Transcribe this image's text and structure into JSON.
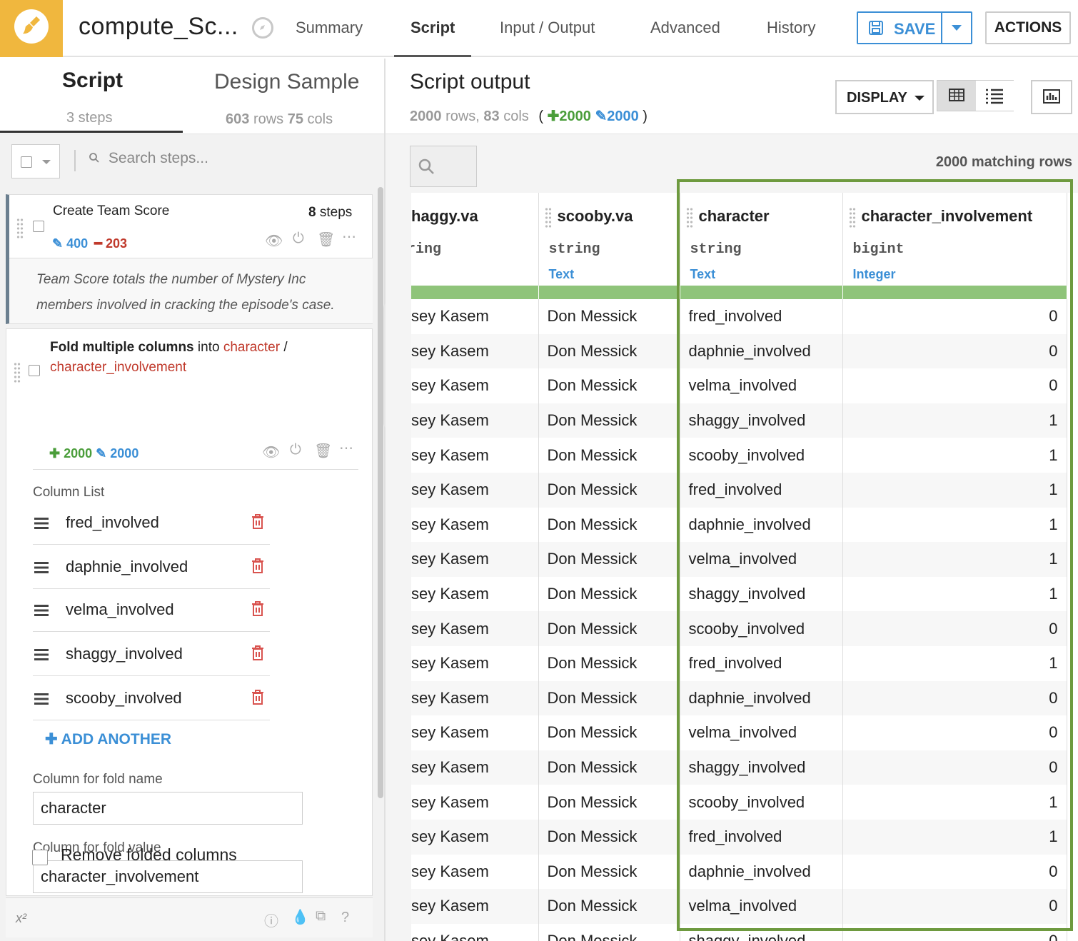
{
  "topbar": {
    "recipe_name": "compute_Sc...",
    "tabs": [
      "Summary",
      "Script",
      "Input / Output",
      "Advanced",
      "History"
    ],
    "active_tab": "Script",
    "save_label": "SAVE",
    "actions_label": "ACTIONS",
    "accent_color": "#3b8fd6",
    "logo_color": "#f0b73e"
  },
  "left": {
    "tab_script": "Script",
    "tab_script_sub": "3 steps",
    "tab_design": "Design Sample",
    "tab_design_rows": "603",
    "tab_design_rows_unit": "rows",
    "tab_design_cols": "75",
    "tab_design_cols_unit": "cols",
    "search_placeholder": "Search steps...",
    "step1": {
      "title": "Create Team Score",
      "count": "8",
      "count_unit": "steps",
      "edited": "400",
      "removed": "203",
      "description": "Team Score totals the number of Mystery Inc members involved in cracking the episode's case."
    },
    "step2": {
      "title_bold": "Fold multiple columns",
      "title_into": "into",
      "title_col1": "character",
      "title_sep": "/",
      "title_col2": "character_involvement",
      "added": "2000",
      "edited": "2000",
      "column_list_label": "Column List",
      "columns": [
        "fred_involved",
        "daphnie_involved",
        "velma_involved",
        "shaggy_involved",
        "scooby_involved"
      ],
      "add_another": "ADD ANOTHER",
      "fold_name_label": "Column for fold name",
      "fold_name_value": "character",
      "fold_value_label": "Column for fold value",
      "fold_value_value": "character_involvement",
      "remove_folded_label": "Remove folded columns",
      "remove_folded_checked": false
    },
    "footer_formula": "x²"
  },
  "right": {
    "title": "Script output",
    "rows": "2000",
    "rows_unit": "rows,",
    "cols": "83",
    "cols_unit": "cols",
    "added": "2000",
    "edited": "2000",
    "display_label": "DISPLAY",
    "matching_rows": "2000 matching rows",
    "columns": [
      {
        "name": "haggy.va",
        "type": "ring",
        "meaning": "t"
      },
      {
        "name": "scooby.va",
        "type": "string",
        "meaning": "Text"
      },
      {
        "name": "character",
        "type": "string",
        "meaning": "Text"
      },
      {
        "name": "character_involvement",
        "type": "bigint",
        "meaning": "Integer"
      }
    ],
    "rows_data": [
      [
        "sey Kasem",
        "Don Messick",
        "fred_involved",
        "0"
      ],
      [
        "sey Kasem",
        "Don Messick",
        "daphnie_involved",
        "0"
      ],
      [
        "sey Kasem",
        "Don Messick",
        "velma_involved",
        "0"
      ],
      [
        "sey Kasem",
        "Don Messick",
        "shaggy_involved",
        "1"
      ],
      [
        "sey Kasem",
        "Don Messick",
        "scooby_involved",
        "1"
      ],
      [
        "sey Kasem",
        "Don Messick",
        "fred_involved",
        "1"
      ],
      [
        "sey Kasem",
        "Don Messick",
        "daphnie_involved",
        "1"
      ],
      [
        "sey Kasem",
        "Don Messick",
        "velma_involved",
        "1"
      ],
      [
        "sey Kasem",
        "Don Messick",
        "shaggy_involved",
        "1"
      ],
      [
        "sey Kasem",
        "Don Messick",
        "scooby_involved",
        "0"
      ],
      [
        "sey Kasem",
        "Don Messick",
        "fred_involved",
        "1"
      ],
      [
        "sey Kasem",
        "Don Messick",
        "daphnie_involved",
        "0"
      ],
      [
        "sey Kasem",
        "Don Messick",
        "velma_involved",
        "0"
      ],
      [
        "sey Kasem",
        "Don Messick",
        "shaggy_involved",
        "0"
      ],
      [
        "sey Kasem",
        "Don Messick",
        "scooby_involved",
        "1"
      ],
      [
        "sey Kasem",
        "Don Messick",
        "fred_involved",
        "1"
      ],
      [
        "sey Kasem",
        "Don Messick",
        "daphnie_involved",
        "0"
      ],
      [
        "sey Kasem",
        "Don Messick",
        "velma_involved",
        "0"
      ],
      [
        "sey Kasem",
        "Don Messick",
        "shaggy_involved",
        "0"
      ]
    ],
    "highlight_color": "#6e9a3f",
    "valid_bar_color": "#8fc47a"
  },
  "icons": [
    "brush-logo-icon",
    "compass-icon",
    "save-disk-icon",
    "caret-down-icon",
    "search-icon",
    "pencil-icon",
    "plus-icon",
    "minus-icon",
    "eye-icon",
    "power-icon",
    "trash-icon",
    "more-icon",
    "grid-view-icon",
    "list-view-icon",
    "chart-icon",
    "info-icon",
    "drop-icon",
    "copy-icon",
    "help-icon"
  ]
}
